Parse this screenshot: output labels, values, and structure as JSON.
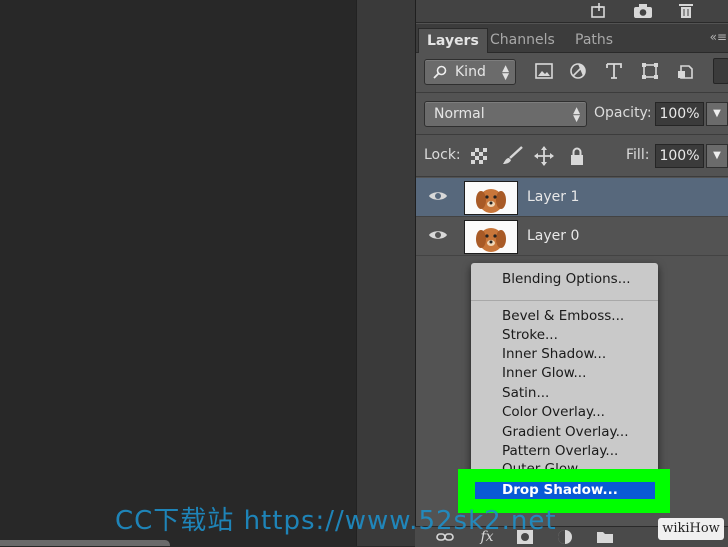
{
  "tabs": {
    "layers": "Layers",
    "channels": "Channels",
    "paths": "Paths"
  },
  "panel_menu_icon": "panel-menu-icon",
  "filter": {
    "kind_label": "Kind",
    "icon": "search-icon"
  },
  "blend": {
    "mode": "Normal",
    "opacity_label": "Opacity:",
    "opacity_value": "100%"
  },
  "lock": {
    "label": "Lock:",
    "fill_label": "Fill:",
    "fill_value": "100%"
  },
  "layers": [
    {
      "name": "Layer 1",
      "selected": true
    },
    {
      "name": "Layer 0",
      "selected": false
    }
  ],
  "context_menu": {
    "blending_options": "Blending Options...",
    "items": [
      "Bevel & Emboss...",
      "Stroke...",
      "Inner Shadow...",
      "Inner Glow...",
      "Satin...",
      "Color Overlay...",
      "Gradient Overlay...",
      "Pattern Overlay...",
      "Outer Glow..."
    ],
    "highlighted": "Drop Shadow..."
  },
  "bottom_bar": {
    "fx_label": "fx"
  },
  "watermark": "CC下载站 https://www.52sk2.net",
  "badge": "wikiHow",
  "colors": {
    "selection": "#57687c",
    "highlight": "#00ff00",
    "menu_hover": "#0a5ad6"
  }
}
